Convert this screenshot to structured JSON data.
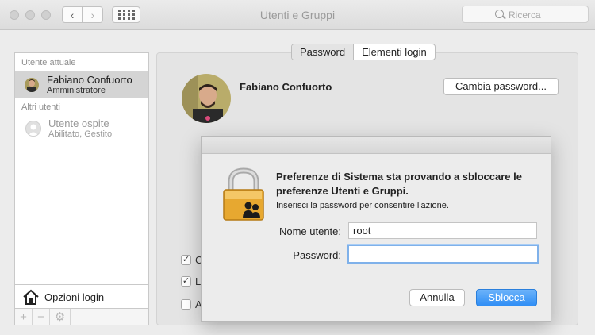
{
  "window": {
    "title": "Utenti e Gruppi",
    "back_icon": "‹",
    "forward_icon": "›",
    "search_placeholder": "Ricerca"
  },
  "sidebar": {
    "current_header": "Utente attuale",
    "current_user": {
      "name": "Fabiano Confuorto",
      "role": "Amministratore"
    },
    "others_header": "Altri utenti",
    "guest_user": {
      "name": "Utente ospite",
      "role": "Abilitato, Gestito"
    },
    "login_options": "Opzioni login",
    "tools": {
      "add": "+",
      "remove": "−",
      "gear": "⚙"
    }
  },
  "main": {
    "tabs": [
      {
        "label": "Password"
      },
      {
        "label": "Elementi login"
      }
    ],
    "user_name": "Fabiano Confuorto",
    "change_password_button": "Cambia password...",
    "checkbox_partial": [
      "C",
      "L",
      "A"
    ],
    "check_mark": "✓"
  },
  "dialog": {
    "title": "Preferenze di Sistema sta provando a sbloccare le preferenze Utenti e Gruppi.",
    "subtitle": "Inserisci la password per consentire l'azione.",
    "username_label": "Nome utente:",
    "username_value": "root",
    "password_label": "Password:",
    "password_value": "",
    "cancel_button": "Annulla",
    "unlock_button": "Sblocca"
  },
  "colors": {
    "accent": "#2f8ef5",
    "selection": "#d4d4d4",
    "lock": "#e7a830"
  }
}
